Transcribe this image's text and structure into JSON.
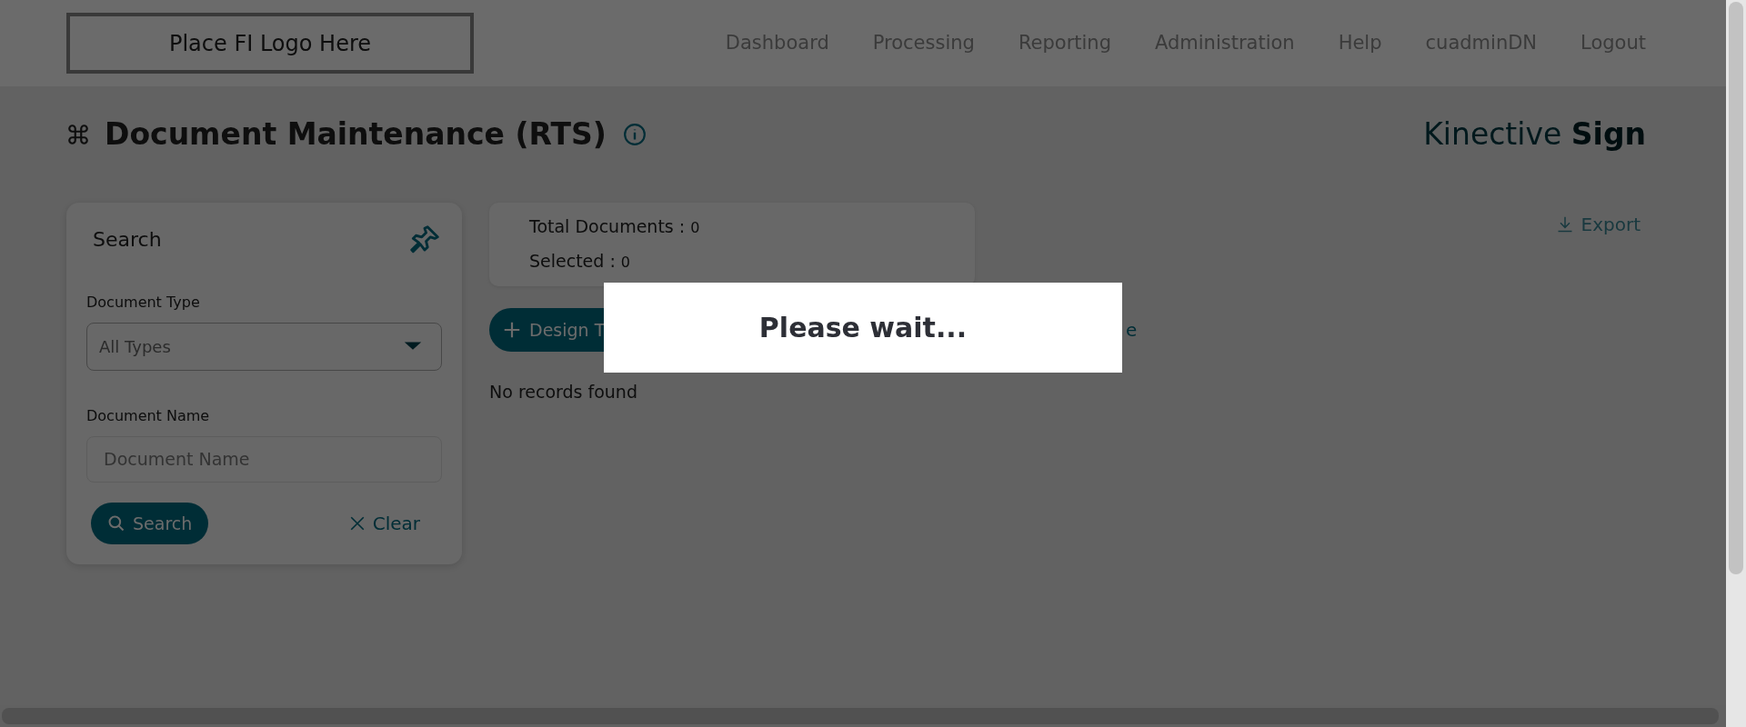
{
  "header": {
    "logo": "Place FI Logo Here",
    "nav": [
      {
        "label": "Dashboard"
      },
      {
        "label": "Processing"
      },
      {
        "label": "Reporting"
      },
      {
        "label": "Administration"
      },
      {
        "label": "Help"
      },
      {
        "label": "cuadminDN"
      },
      {
        "label": "Logout"
      }
    ]
  },
  "page": {
    "title": "Document Maintenance (RTS)",
    "brand": "Kinective **Sign**"
  },
  "search_panel": {
    "title": "Search",
    "fields": [
      {
        "kind": "select",
        "label": "Document Type",
        "value": "All Types"
      },
      {
        "kind": "text",
        "label": "Document Name",
        "placeholder": "Document Name"
      }
    ],
    "buttons": [
      {
        "kind": "primary",
        "label": "Search"
      },
      {
        "kind": "link",
        "label": "Clear"
      }
    ]
  },
  "summary": [
    {
      "label": "Total Documents :",
      "value": "0"
    },
    {
      "label": "Selected :",
      "value": "0"
    }
  ],
  "export": {
    "label": "Export",
    "disabled": true
  },
  "actions": [
    {
      "kind": "primary",
      "label": "Design T"
    },
    {
      "kind": "link",
      "label": "e"
    }
  ],
  "empty_message": "No records found",
  "loading": {
    "message": "Please wait..."
  }
}
